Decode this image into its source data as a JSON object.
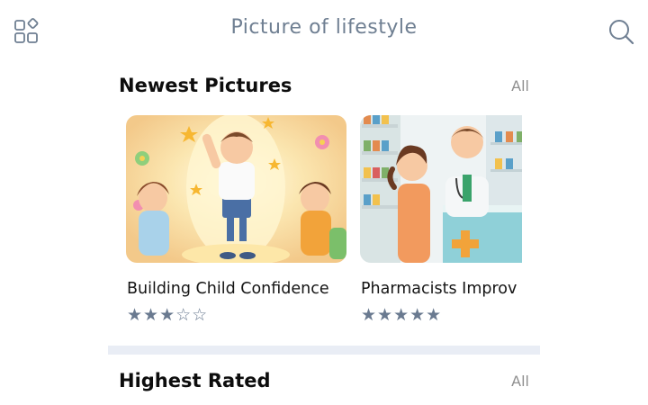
{
  "header": {
    "title": "Picture of lifestyle",
    "left_icon": "apps-icon",
    "right_icon": "search-icon"
  },
  "sections": [
    {
      "title": "Newest Pictures",
      "all_label": "All",
      "cards": [
        {
          "title": "Building Child Confidence",
          "stars": "★★★☆☆",
          "rating": 3
        },
        {
          "title": "Pharmacists Improv",
          "stars": "★★★★★",
          "rating": 5
        }
      ]
    },
    {
      "title": "Highest Rated",
      "all_label": "All"
    }
  ],
  "colors": {
    "title_gray": "#6f7f92",
    "star": "#6a7a90",
    "divider": "#e9edf5"
  }
}
